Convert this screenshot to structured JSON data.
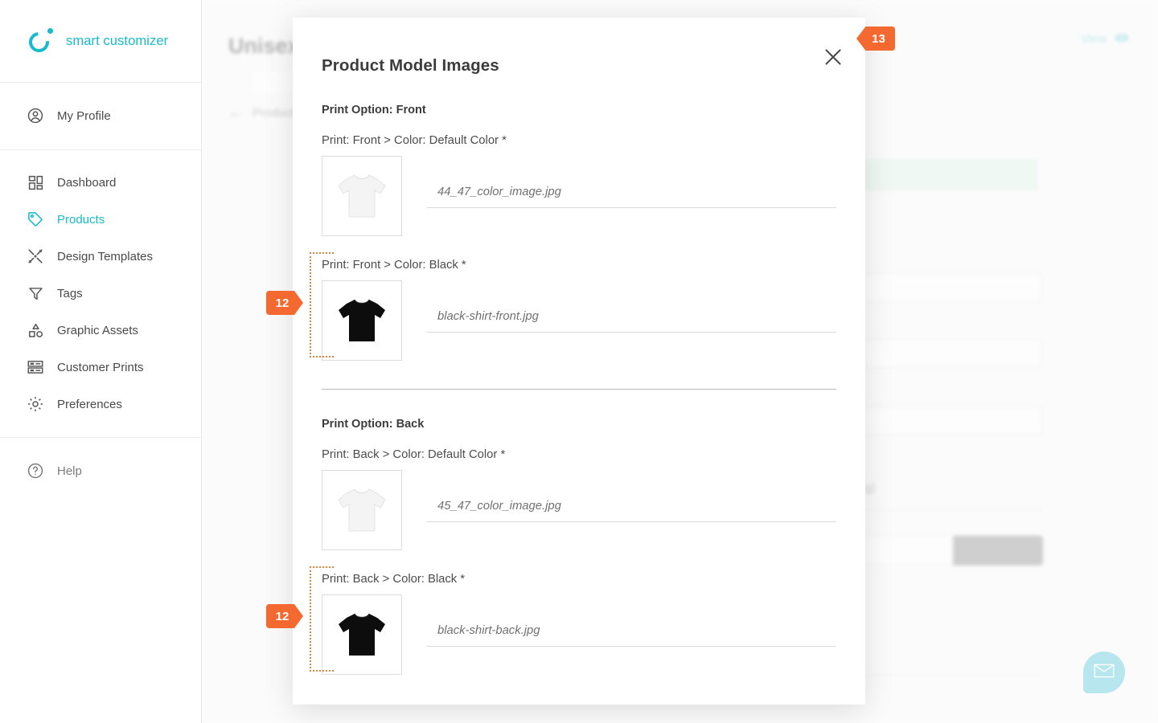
{
  "brand": {
    "name": "smart customizer"
  },
  "sidebar": {
    "profile": [
      {
        "label": "My Profile",
        "icon": "user-circle-icon"
      }
    ],
    "items": [
      {
        "label": "Dashboard",
        "icon": "dashboard-icon",
        "active": false
      },
      {
        "label": "Products",
        "icon": "tag-icon",
        "active": true
      },
      {
        "label": "Design Templates",
        "icon": "design-templates-icon",
        "active": false
      },
      {
        "label": "Tags",
        "icon": "funnel-icon",
        "active": false
      },
      {
        "label": "Graphic Assets",
        "icon": "shapes-icon",
        "active": false
      },
      {
        "label": "Customer Prints",
        "icon": "prints-icon",
        "active": false
      },
      {
        "label": "Preferences",
        "icon": "gear-icon",
        "active": false
      }
    ],
    "help": {
      "label": "Help",
      "icon": "help-circle-icon"
    }
  },
  "background_page": {
    "title": "Unisex C",
    "breadcrumb_label": "Products",
    "view_label": "View",
    "view_icon": "eye-icon",
    "file_hint": "sions: .jpg,.jpeg,.png)"
  },
  "modal": {
    "title": "Product Model Images",
    "close_icon": "close-icon",
    "sections": [
      {
        "heading": "Print Option: Front",
        "rows": [
          {
            "label": "Print: Front > Color: Default Color *",
            "filename": "44_47_color_image.jpg",
            "thumb": "white-tshirt",
            "highlighted": false
          },
          {
            "label": "Print: Front > Color: Black *",
            "filename": "black-shirt-front.jpg",
            "thumb": "black-tshirt",
            "highlighted": true
          }
        ]
      },
      {
        "heading": "Print Option: Back",
        "rows": [
          {
            "label": "Print: Back > Color: Default Color *",
            "filename": "45_47_color_image.jpg",
            "thumb": "white-tshirt",
            "highlighted": false
          },
          {
            "label": "Print: Back > Color: Black *",
            "filename": "black-shirt-back.jpg",
            "thumb": "black-tshirt",
            "highlighted": true
          }
        ]
      }
    ]
  },
  "step_badges": [
    {
      "id": "13",
      "label": "13",
      "direction": "left-point"
    },
    {
      "id": "12a",
      "label": "12",
      "direction": "right-point"
    },
    {
      "id": "12b",
      "label": "12",
      "direction": "right-point"
    }
  ],
  "chat_widget": {
    "icon": "envelope-icon"
  },
  "colors": {
    "brand_teal": "#16bccd",
    "badge_orange": "#f4692f",
    "highlight_dotted": "#e2823e",
    "success_green": "#eaf7ef"
  }
}
